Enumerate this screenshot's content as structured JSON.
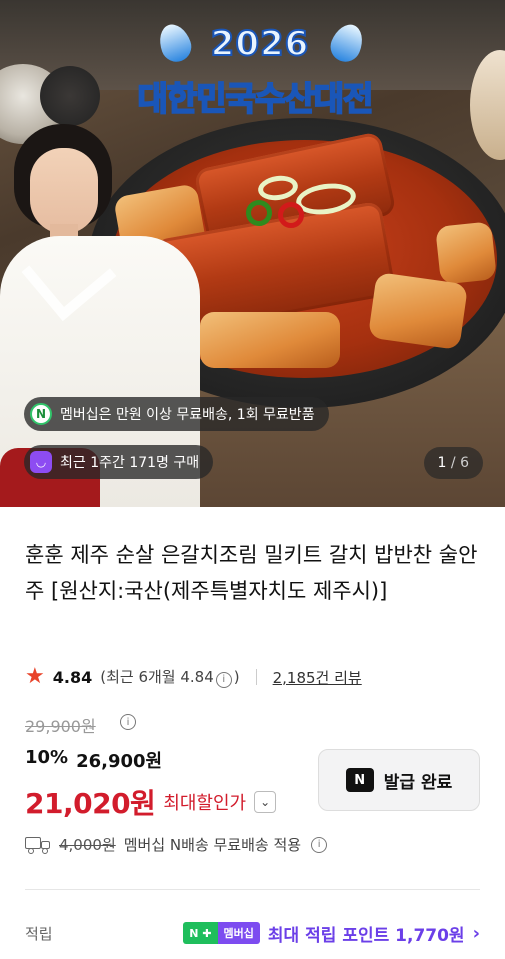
{
  "hero": {
    "logo_year": "2026",
    "logo_title": "대한민국수산대전",
    "chip_membership": "멤버십은 만원 이상 무료배송, 1회 무료반품",
    "chip_recent": "최근 1주간 171명 구매",
    "page_current": "1",
    "page_total": "/ 6"
  },
  "product": {
    "title": "훈훈 제주 순살 은갈치조림 밀키트 갈치 밥반찬 술안주 [원산지:국산(제주특별자치도 제주시)]",
    "rating": "4.84",
    "rating_note": "(최근 6개월 4.84",
    "rating_close": ")",
    "reviews": "2,185건 리뷰"
  },
  "price": {
    "original": "29,900원",
    "discount_pct": "10%",
    "discounted": "26,900원",
    "final": "21,020원",
    "final_label": "최대할인가",
    "coupon_badge": "N",
    "coupon_label": "발급 완료"
  },
  "shipping": {
    "old_fee": "4,000원",
    "text": "멤버십 N배송 무료배송 적용"
  },
  "points": {
    "label": "적립",
    "badge_n": "N ✚",
    "badge_member": "멤버십",
    "text": "최대 적립 포인트 1,770원"
  },
  "colors": {
    "accent_red": "#d21c2c",
    "accent_purple": "#6b3fe8",
    "naver_green": "#1fbe5c"
  },
  "icons": [
    "star-icon",
    "info-icon",
    "truck-icon",
    "chevron-down-icon",
    "chevron-right-icon",
    "naver-n-icon",
    "shopping-bag-icon"
  ]
}
